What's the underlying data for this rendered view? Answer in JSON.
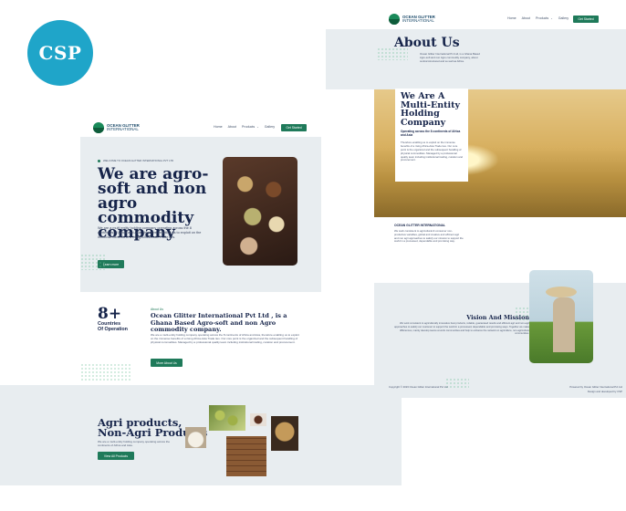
{
  "badge": {
    "text": "CSP"
  },
  "left_page": {
    "brand": {
      "line1": "OCEAN GLITTER",
      "line2": "INTERNATIONAL"
    },
    "nav": [
      "Home",
      "About",
      "Products",
      "Gallery"
    ],
    "nav_cta": "Get Started",
    "hero": {
      "eyebrow": "WELCOME TO OCEAN GLITTER INTERNATIONAL PVT LTD",
      "title": "We are agro-soft and non agro commodity company",
      "body": "We are a multi entity holding company operating across the 8 continents of Africa and Asia, therefore enabling us to exploit on the immense benefits of a rising Africa-Asia Trade ties.",
      "cta": "Learn more"
    },
    "stats": {
      "number": "8+",
      "label1": "Countries",
      "label2": "Of Operation"
    },
    "about": {
      "eyebrow": "About Us",
      "title": "Ocean Glitter International Pvt Ltd , is a Ghana Based Agro-soft and non Agro commodity company.",
      "body": "We are a multi-entity holding company operating across the 8 continents of Africa and Asia, therefore enabling us to exploit on the immense benefits of a rising Africa-Asia Trade ties. Our core point is the organized and the subsequent handling of physical commodities. Managed by a professional quality team including institutional trading, curation and procurement.",
      "cta": "More About Us"
    },
    "products": {
      "title1": "Agri products,",
      "title2": "Non-Agri Products",
      "body": "We are a multi-entity holding company operating across the continents of Africa and Asia.",
      "cta": "View All Products"
    }
  },
  "right_page": {
    "brand": {
      "line1": "OCEAN GLITTER",
      "line2": "INTERNATIONAL"
    },
    "nav": [
      "Home",
      "About",
      "Products",
      "Gallery"
    ],
    "nav_cta": "Get Started",
    "about_title": "About Us",
    "about_body": "Ocean Glitter International Pvt Ltd, is a Ghana Based Agro-soft and non Agro commodity company, about central structured and so well as Africa.",
    "multi": {
      "title": "We Are A Multi-Entity Holding Company",
      "subtitle": "Operating across the 8 continents of Africa and Asia",
      "body": "Therefore enabling us to exploit on the immense benefits of a rising Africa-Asia Trade ties. Our core point is the organized and the subsequent handling of physical commodities. Managed by a professional quality team including institutional trading, curation and procurement."
    },
    "company": {
      "heading": "OCEAN GLITTER INTERNATIONAL",
      "body": "We work consistent to agricultural & consumer non-productive variables, global and creative and efficient agri and non agri approaches to satisfy our mission to support the world in a processed, dependable and promising way."
    },
    "vision": {
      "title": "Vision And Mission",
      "body": "We work consistent to agriculturally innovative best products, reliable, guaranteed results and efficient agri and non-agri approaches to satisfy our customer to support the world in a processed, dependable and promising ways. Together we make differences, mainly develop teams at work communities and help to enhance the network on agriculture, non-agriculture communities."
    },
    "footer": {
      "copyright": "Copyright © 2023 Ocean Glitter International Pvt Ltd",
      "powered1": "Powered by Ocean Glitter International Pvt Ltd",
      "powered2": "Design and developed by CSP"
    }
  },
  "colors": {
    "accent": "#1f7a5a",
    "navy": "#1b2a4a",
    "badge": "#1fa5c9",
    "light_bg": "#e8edf0"
  }
}
